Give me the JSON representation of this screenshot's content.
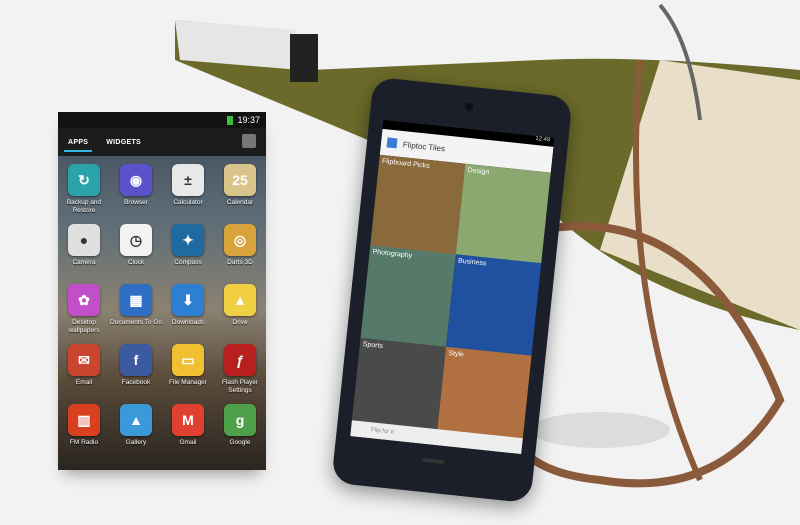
{
  "status_bar": {
    "time": "19:37"
  },
  "tabs": [
    {
      "label": "APPS",
      "active": true
    },
    {
      "label": "WIDGETS",
      "active": false
    }
  ],
  "apps": [
    {
      "label": "Backup and Restore",
      "icon": "backup-icon",
      "color": "#2aa4a8",
      "glyph": "↻"
    },
    {
      "label": "Browser",
      "icon": "browser-icon",
      "color": "#5b52c9",
      "glyph": "◉"
    },
    {
      "label": "Calculator",
      "icon": "calculator-icon",
      "color": "#e8e8e8",
      "glyph": "±"
    },
    {
      "label": "Calendar",
      "icon": "calendar-icon",
      "color": "#d9c48a",
      "glyph": "25"
    },
    {
      "label": "Camera",
      "icon": "camera-icon",
      "color": "#e0e0e0",
      "glyph": "●"
    },
    {
      "label": "Clock",
      "icon": "clock-icon",
      "color": "#f2f2f2",
      "glyph": "◷"
    },
    {
      "label": "Compass",
      "icon": "compass-icon",
      "color": "#1f6aa0",
      "glyph": "✦"
    },
    {
      "label": "Darts 3D",
      "icon": "darts-icon",
      "color": "#d8a33a",
      "glyph": "◎"
    },
    {
      "label": "Desktop wallpapers",
      "icon": "wallpaper-icon",
      "color": "#c04fc9",
      "glyph": "✿"
    },
    {
      "label": "Documents To Go",
      "icon": "documents-icon",
      "color": "#2e6fc4",
      "glyph": "▦"
    },
    {
      "label": "Downloads",
      "icon": "downloads-icon",
      "color": "#2d7fd4",
      "glyph": "⬇"
    },
    {
      "label": "Drive",
      "icon": "drive-icon",
      "color": "#f0d040",
      "glyph": "▲"
    },
    {
      "label": "Email",
      "icon": "email-icon",
      "color": "#c9452f",
      "glyph": "✉"
    },
    {
      "label": "Facebook",
      "icon": "facebook-icon",
      "color": "#3b5aa0",
      "glyph": "f"
    },
    {
      "label": "File Manager",
      "icon": "file-manager-icon",
      "color": "#f0c030",
      "glyph": "▭"
    },
    {
      "label": "Flash Player Settings",
      "icon": "flash-icon",
      "color": "#b82020",
      "glyph": "ƒ"
    },
    {
      "label": "FM Radio",
      "icon": "radio-icon",
      "color": "#d84020",
      "glyph": "▥"
    },
    {
      "label": "Gallery",
      "icon": "gallery-icon",
      "color": "#3a9ad9",
      "glyph": "▲"
    },
    {
      "label": "Gmail",
      "icon": "gmail-icon",
      "color": "#e04030",
      "glyph": "M"
    },
    {
      "label": "Google",
      "icon": "google-icon",
      "color": "#4fa04a",
      "glyph": "g"
    }
  ],
  "phone": {
    "time": "12:48",
    "header_title": "Fliptoc Tiles",
    "tiles": [
      "Flipboard Picks",
      "Design",
      "Photography",
      "Business",
      "Sports",
      "Style"
    ],
    "search_hint": "Flip for it"
  }
}
